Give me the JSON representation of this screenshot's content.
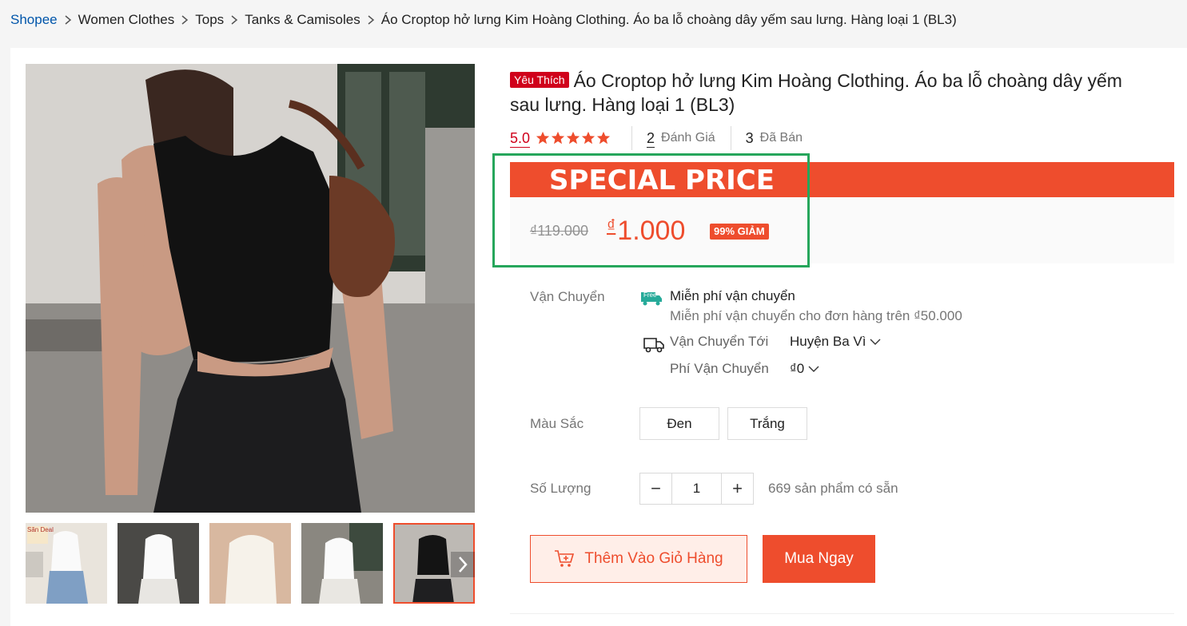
{
  "breadcrumb": {
    "items": [
      "Shopee",
      "Women Clothes",
      "Tops",
      "Tanks & Camisoles"
    ],
    "current": "Áo Croptop hở lưng Kim Hoàng Clothing. Áo ba lỗ choàng dây yếm sau lưng. Hàng loại 1 (BL3)"
  },
  "gallery": {
    "main_image_alt": "woman in black halter crop top and black jeans",
    "thumbnails": [
      {
        "label": "white halter top with Săn Deal badge",
        "overlay_text": "Săn Deal"
      },
      {
        "label": "white halter top"
      },
      {
        "label": "cream halter top close-up"
      },
      {
        "label": "white halter top street"
      },
      {
        "label": "black halter top",
        "active": true
      }
    ]
  },
  "product": {
    "badge": "Yêu Thích",
    "title": "Áo Croptop hở lưng Kim Hoàng Clothing. Áo ba lỗ choàng dây yếm sau lưng. Hàng loại 1 (BL3)",
    "rating": "5.0",
    "stars": 5,
    "reviews_count": "2",
    "reviews_label": "Đánh Giá",
    "sold_count": "3",
    "sold_label": "Đã Bán"
  },
  "price": {
    "banner": "SPECIAL PRICE",
    "original": "₫119.000",
    "currency": "₫",
    "current": "1.000",
    "discount": "99% GIẢM"
  },
  "shipping": {
    "label": "Vận Chuyển",
    "free_badge": "Free",
    "free_title": "Miễn phí vận chuyển",
    "free_desc": "Miễn phí vận chuyển cho đơn hàng trên ₫50.000",
    "to_label": "Vận Chuyển Tới",
    "to_value": "Huyện Ba Vì",
    "fee_label": "Phí Vận Chuyển",
    "fee_value": "₫0"
  },
  "variation": {
    "label": "Màu Sắc",
    "options": [
      "Đen",
      "Trắng"
    ]
  },
  "quantity": {
    "label": "Số Lượng",
    "value": "1",
    "minus": "−",
    "plus": "+",
    "stock": "669 sản phẩm có sẵn"
  },
  "actions": {
    "add_to_cart": "Thêm Vào Giỏ Hàng",
    "buy_now": "Mua Ngay"
  },
  "colors": {
    "brand": "#ee4d2d",
    "star": "#ee4d2d",
    "favorite_badge": "#d0011b",
    "highlight_outline": "#26a65b",
    "link": "#0055aa"
  }
}
